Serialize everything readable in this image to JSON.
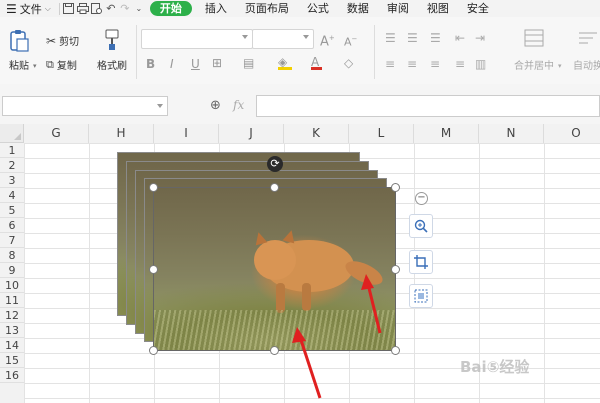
{
  "menubar": {
    "file_label": "文件",
    "tabs": [
      "开始",
      "插入",
      "页面布局",
      "公式",
      "数据",
      "审阅",
      "视图",
      "安全"
    ],
    "active_tab_index": 0
  },
  "ribbon": {
    "paste": "粘贴",
    "cut": "剪切",
    "copy": "复制",
    "format_painter": "格式刷",
    "merge_center": "合并居中",
    "auto_wrap": "自动换"
  },
  "formula_bar": {
    "fx_label": "fx"
  },
  "sheet": {
    "columns": [
      "G",
      "H",
      "I",
      "J",
      "K",
      "L",
      "M",
      "N",
      "O"
    ],
    "rows": [
      "1",
      "2",
      "3",
      "4",
      "5",
      "6",
      "7",
      "8",
      "9",
      "10",
      "11",
      "12",
      "13",
      "14",
      "15",
      "16"
    ]
  },
  "watermark": "Bai⑤经验",
  "colors": {
    "active_tab": "#2db04a",
    "arrow": "#e02020",
    "side_button_icon": "#3a6fb8"
  },
  "icons": [
    "menu-icon",
    "save-icon",
    "print-icon",
    "preview-icon",
    "undo-icon",
    "redo-icon",
    "zoom-icon",
    "crop-icon",
    "image-edit-icon",
    "rotate-icon",
    "minus-icon"
  ]
}
